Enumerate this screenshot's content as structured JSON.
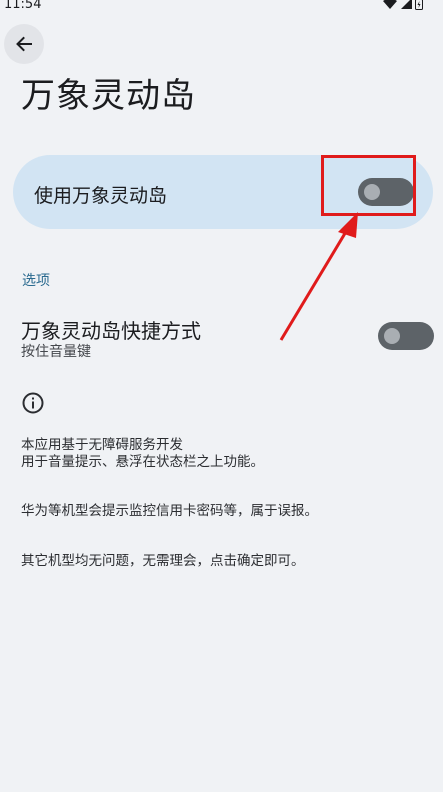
{
  "status_bar": {
    "time": "11:54",
    "icons": [
      "wifi-icon",
      "cell-signal-icon",
      "battery-icon"
    ]
  },
  "page": {
    "title": "万象灵动岛"
  },
  "master_switch": {
    "label": "使用万象灵动岛",
    "enabled": false
  },
  "section": {
    "header": "选项"
  },
  "shortcut": {
    "title": "万象灵动岛快捷方式",
    "subtitle": "按住音量键",
    "enabled": false
  },
  "info": {
    "icon": "info-icon",
    "paragraph1_line1": "本应用基于无障碍服务开发",
    "paragraph1_line2": "用于音量提示、悬浮在状态栏之上功能。",
    "paragraph2": "华为等机型会提示监控信用卡密码等，属于误报。",
    "paragraph3": "其它机型均无问题，无需理会，点击确定即可。"
  },
  "annotation": {
    "color": "#e01b1b"
  }
}
